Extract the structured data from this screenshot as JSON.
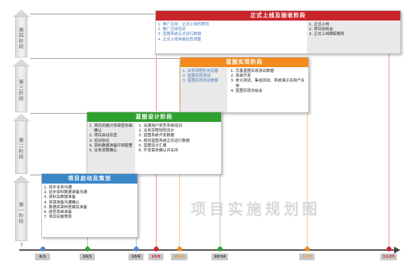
{
  "phases": [
    {
      "id": "phase4",
      "label": "第四阶段"
    },
    {
      "id": "phase3",
      "label": "第三阶段"
    },
    {
      "id": "phase2",
      "label": "第二阶段"
    },
    {
      "id": "phase1",
      "label": "第一阶段"
    }
  ],
  "stages": {
    "launch": {
      "title": "项目启动及策划",
      "color": "#3a87c8",
      "col1": [
        "初步业务沟通",
        "初步资料数据准备沟通",
        "资料及数据准备",
        "资源准备沟通确认",
        "数据库架构搭建及准备",
        "原型系统准备",
        "项目实施策划"
      ]
    },
    "blueprint": {
      "title": "蓝图设计阶段",
      "color": "#2ea02e",
      "col1": [
        "项目实施计划审查协商确认",
        "项目启动及宣",
        "培训协议",
        "资料数据准备环境配置",
        "业务流程确认"
      ],
      "col2": [
        "关键用户原型系统培训",
        "业务流程规划设计",
        "蓝图系统开发数据",
        "规划蓝图系统正式运行数据",
        "蓝图设计汇报",
        "开发需求确认并关闭"
      ]
    },
    "realize": {
      "title": "蓝图实现阶段",
      "color": "#f28a1e",
      "col1": [
        "业务流程补充完善",
        "蓝图实现测试",
        "蓝图实现测试数据"
      ],
      "col2": [
        "完善蓝图实现测试数据",
        "系统开发",
        "单元测试、集成测试、系统演示及用户反馈",
        "蓝图实现总结会"
      ]
    },
    "golive": {
      "title": "正式上线及验收阶段",
      "color": "#c9262c",
      "col1": [
        "推广应用、正式上线的策划",
        "推广应用培训",
        "蓝图系统正式运行数据",
        "正式上线准备检查调整"
      ],
      "col2": [
        "正式上线",
        "项目验收会",
        "正式上线跟踪服务"
      ]
    }
  },
  "timeline": {
    "start": "T",
    "dates": [
      {
        "label": "6/1",
        "color": "#4a86c8"
      },
      {
        "label": "10/1",
        "color": "#2ea02e"
      },
      {
        "label": "10/6",
        "color": "#4a86c8"
      },
      {
        "label": "10/8",
        "color": "#c9262c"
      },
      {
        "label": "10/11",
        "color": "#f28a1e"
      },
      {
        "label": "10/16",
        "color": "#2ea02e"
      },
      {
        "label": "11/2",
        "color": "#f28a1e"
      },
      {
        "label": "11/25",
        "color": "#c9262c"
      }
    ]
  },
  "watermark": "项目实施规划图"
}
